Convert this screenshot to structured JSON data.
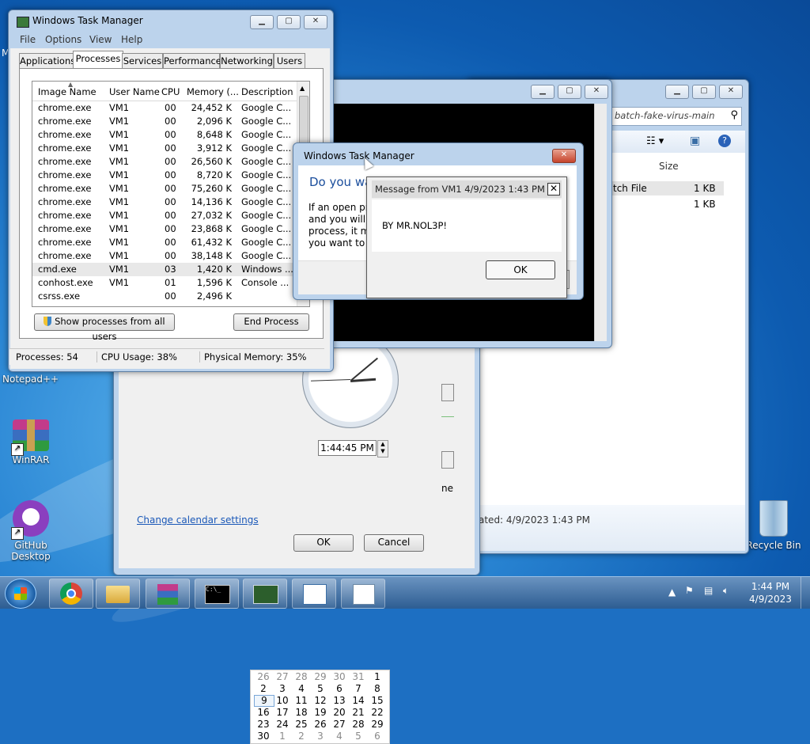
{
  "desktop": {
    "icons": [
      {
        "label": "Notepad++"
      },
      {
        "label": "WinRAR"
      },
      {
        "label": "GitHub Desktop"
      },
      {
        "label": "Recycle Bin"
      }
    ]
  },
  "explorer": {
    "path": "batch-fake-virus-main",
    "column_size": "Size",
    "rows": [
      {
        "name": "tch File",
        "size": "1 KB"
      },
      {
        "name": "",
        "size": "1 KB"
      }
    ],
    "status": "ated: 4/9/2023 1:43 PM"
  },
  "datetime_dialog": {
    "calendar_rows": [
      [
        "26",
        "27",
        "28",
        "29",
        "30",
        "31",
        "1"
      ],
      [
        "2",
        "3",
        "4",
        "5",
        "6",
        "7",
        "8"
      ],
      [
        "9",
        "10",
        "11",
        "12",
        "13",
        "14",
        "15"
      ],
      [
        "16",
        "17",
        "18",
        "19",
        "20",
        "21",
        "22"
      ],
      [
        "23",
        "24",
        "25",
        "26",
        "27",
        "28",
        "29"
      ],
      [
        "30",
        "1",
        "2",
        "3",
        "4",
        "5",
        "6"
      ]
    ],
    "selected_day": "9",
    "time_value": "1:44:45 PM",
    "change_link": "Change calendar settings",
    "ok_label": "OK",
    "cancel_label": "Cancel",
    "partial_text": "ne"
  },
  "taskmgr": {
    "title": "Windows Task Manager",
    "menu": [
      "File",
      "Options",
      "View",
      "Help"
    ],
    "tabs": [
      "Applications",
      "Processes",
      "Services",
      "Performance",
      "Networking",
      "Users"
    ],
    "active_tab": "Processes",
    "columns": [
      "Image Name",
      "User Name",
      "CPU",
      "Memory (...",
      "Description"
    ],
    "processes": [
      {
        "name": "chrome.exe",
        "user": "VM1",
        "cpu": "00",
        "mem": "24,452 K",
        "desc": "Google C..."
      },
      {
        "name": "chrome.exe",
        "user": "VM1",
        "cpu": "00",
        "mem": "2,096 K",
        "desc": "Google C..."
      },
      {
        "name": "chrome.exe",
        "user": "VM1",
        "cpu": "00",
        "mem": "8,648 K",
        "desc": "Google C..."
      },
      {
        "name": "chrome.exe",
        "user": "VM1",
        "cpu": "00",
        "mem": "3,912 K",
        "desc": "Google C..."
      },
      {
        "name": "chrome.exe",
        "user": "VM1",
        "cpu": "00",
        "mem": "26,560 K",
        "desc": "Google C..."
      },
      {
        "name": "chrome.exe",
        "user": "VM1",
        "cpu": "00",
        "mem": "8,720 K",
        "desc": "Google C..."
      },
      {
        "name": "chrome.exe",
        "user": "VM1",
        "cpu": "00",
        "mem": "75,260 K",
        "desc": "Google C..."
      },
      {
        "name": "chrome.exe",
        "user": "VM1",
        "cpu": "00",
        "mem": "14,136 K",
        "desc": "Google C..."
      },
      {
        "name": "chrome.exe",
        "user": "VM1",
        "cpu": "00",
        "mem": "27,032 K",
        "desc": "Google C..."
      },
      {
        "name": "chrome.exe",
        "user": "VM1",
        "cpu": "00",
        "mem": "23,868 K",
        "desc": "Google C..."
      },
      {
        "name": "chrome.exe",
        "user": "VM1",
        "cpu": "00",
        "mem": "61,432 K",
        "desc": "Google C..."
      },
      {
        "name": "chrome.exe",
        "user": "VM1",
        "cpu": "00",
        "mem": "38,148 K",
        "desc": "Google C..."
      },
      {
        "name": "cmd.exe",
        "user": "VM1",
        "cpu": "03",
        "mem": "1,420 K",
        "desc": "Windows ..."
      },
      {
        "name": "conhost.exe",
        "user": "VM1",
        "cpu": "01",
        "mem": "1,596 K",
        "desc": "Console ..."
      },
      {
        "name": "csrss.exe",
        "user": "",
        "cpu": "00",
        "mem": "2,496 K",
        "desc": ""
      }
    ],
    "selected_index": 12,
    "show_all_label": "Show processes from all users",
    "end_process_label": "End Process",
    "status_processes": "Processes: 54",
    "status_cpu": "CPU Usage: 38%",
    "status_memory": "Physical Memory: 35%"
  },
  "confirm_dialog": {
    "title": "Windows Task Manager",
    "heading": "Do you wa",
    "body_lines": [
      "If an open pro",
      "and you will lo",
      "process, it mig",
      "you want to c"
    ]
  },
  "message_box": {
    "title": "Message from VM1 4/9/2023 1:43 PM",
    "text": "BY MR.NOL3P!",
    "ok_label": "OK"
  },
  "taskbar": {
    "time": "1:44 PM",
    "date": "4/9/2023"
  }
}
